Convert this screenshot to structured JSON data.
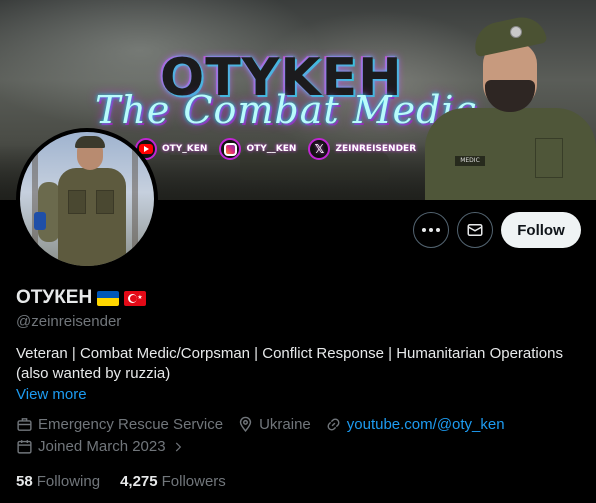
{
  "banner": {
    "brand": "OTYKEH",
    "subtitle": "The Combat Medic",
    "socials": [
      {
        "icon": "youtube-icon",
        "label": "OTY_KEN"
      },
      {
        "icon": "instagram-icon",
        "label": "OTY__KEN"
      },
      {
        "icon": "x-icon",
        "label": "ZEINREISENDER"
      }
    ],
    "patch_text": "MEDIC"
  },
  "actions": {
    "more_icon": "more-icon",
    "message_icon": "envelope-icon",
    "follow_label": "Follow"
  },
  "profile": {
    "name": "ОТУКЕН",
    "flags": [
      "ukraine-flag",
      "turkey-flag"
    ],
    "handle": "@zeinreisender",
    "bio": "Veteran | Combat Medic/Corpsman | Conflict Response | Humanitarian Operations (also wanted by ruzzia)",
    "view_more": "View more",
    "category": "Emergency Rescue Service",
    "location": "Ukraine",
    "website": "youtube.com/@oty_ken",
    "joined": "Joined March 2023"
  },
  "stats": {
    "following_count": "58",
    "following_label": "Following",
    "followers_count": "4,275",
    "followers_label": "Followers"
  },
  "colors": {
    "background": "#000000",
    "text_primary": "#e7e9ea",
    "text_secondary": "#71767b",
    "link": "#1d9bf0",
    "follow_bg": "#eff3f4"
  }
}
